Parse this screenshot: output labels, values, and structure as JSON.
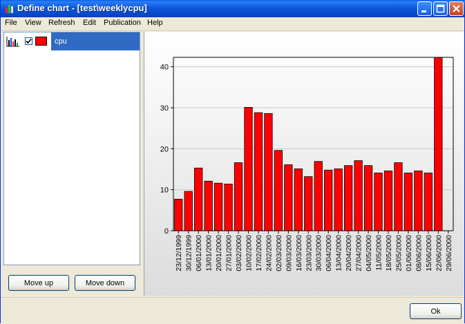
{
  "window": {
    "title": "Define chart - [test\\weeklycpu]",
    "controls": {
      "minimize": "minimize",
      "maximize": "maximize",
      "close": "close"
    }
  },
  "menu": [
    "File",
    "View",
    "Refresh",
    "Edit",
    "Publication",
    "Help"
  ],
  "series_list": [
    {
      "label": "cpu",
      "checked": true,
      "color": "#ff0000",
      "icon": "bar-chart-icon"
    }
  ],
  "buttons": {
    "move_up": "Move up",
    "move_down": "Move down",
    "ok": "Ok"
  },
  "chart_data": {
    "type": "bar",
    "categories": [
      "23/12/1999",
      "30/12/1999",
      "06/01/2000",
      "13/01/2000",
      "20/01/2000",
      "27/01/2000",
      "03/02/2000",
      "10/02/2000",
      "17/02/2000",
      "24/02/2000",
      "02/03/2000",
      "09/03/2000",
      "16/03/2000",
      "23/03/2000",
      "30/03/2000",
      "06/04/2000",
      "13/04/2000",
      "20/04/2000",
      "27/04/2000",
      "04/05/2000",
      "11/05/2000",
      "18/05/2000",
      "25/05/2000",
      "01/06/2000",
      "08/06/2000",
      "15/06/2000",
      "22/06/2000",
      "29/06/2000"
    ],
    "series": [
      {
        "values": [
          7.7,
          9.6,
          15.3,
          12.1,
          11.6,
          11.4,
          16.6,
          30.1,
          28.8,
          28.6,
          19.6,
          16.1,
          15.1,
          13.2,
          16.9,
          14.8,
          15.1,
          15.9,
          17.1,
          15.9,
          14.1,
          14.6,
          16.6,
          14.1,
          14.6,
          14.1,
          42.3
        ]
      }
    ],
    "yticks": [
      0,
      10,
      20,
      30,
      40
    ],
    "ylim": [
      0,
      42.3
    ],
    "grid": true,
    "bar_color": "#ff0000",
    "title": "",
    "xlabel": "",
    "ylabel": ""
  }
}
